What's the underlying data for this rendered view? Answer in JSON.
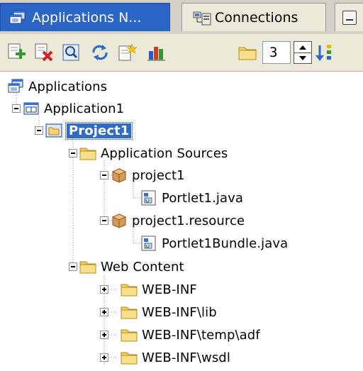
{
  "tabs": [
    {
      "label": "Applications N...",
      "icon": "applications-navigator-icon",
      "active": true
    },
    {
      "label": "Connections",
      "icon": "connections-icon",
      "active": false
    }
  ],
  "toolbar": {
    "buttons": [
      {
        "name": "add-icon"
      },
      {
        "name": "remove-icon"
      },
      {
        "name": "search-icon"
      },
      {
        "name": "refresh-icon"
      },
      {
        "name": "new-icon"
      },
      {
        "name": "chart-icon"
      },
      {
        "name": "folder-icon"
      }
    ],
    "level_value": "3",
    "sort_icon": "sort-icon"
  },
  "tree": {
    "nodes": [
      {
        "label": "Applications",
        "icon": "applications-icon",
        "expander": "none"
      },
      {
        "label": "Application1",
        "icon": "application-icon",
        "expander": "minus"
      },
      {
        "label": "Project1",
        "icon": "project-icon",
        "expander": "minus",
        "selected": true
      },
      {
        "label": "Application Sources",
        "icon": "folder-icon",
        "expander": "minus"
      },
      {
        "label": "project1",
        "icon": "package-icon",
        "expander": "minus"
      },
      {
        "label": "Portlet1.java",
        "icon": "java-file-icon",
        "expander": "none"
      },
      {
        "label": "project1.resource",
        "icon": "package-icon",
        "expander": "minus"
      },
      {
        "label": "Portlet1Bundle.java",
        "icon": "java-file-icon",
        "expander": "none"
      },
      {
        "label": "Web Content",
        "icon": "folder-icon",
        "expander": "minus"
      },
      {
        "label": "WEB-INF",
        "icon": "folder-icon",
        "expander": "plus"
      },
      {
        "label": "WEB-INF\\lib",
        "icon": "folder-icon",
        "expander": "plus"
      },
      {
        "label": "WEB-INF\\temp\\adf",
        "icon": "folder-icon",
        "expander": "plus"
      },
      {
        "label": "WEB-INF\\wsdl",
        "icon": "folder-icon",
        "expander": "plus"
      }
    ]
  }
}
